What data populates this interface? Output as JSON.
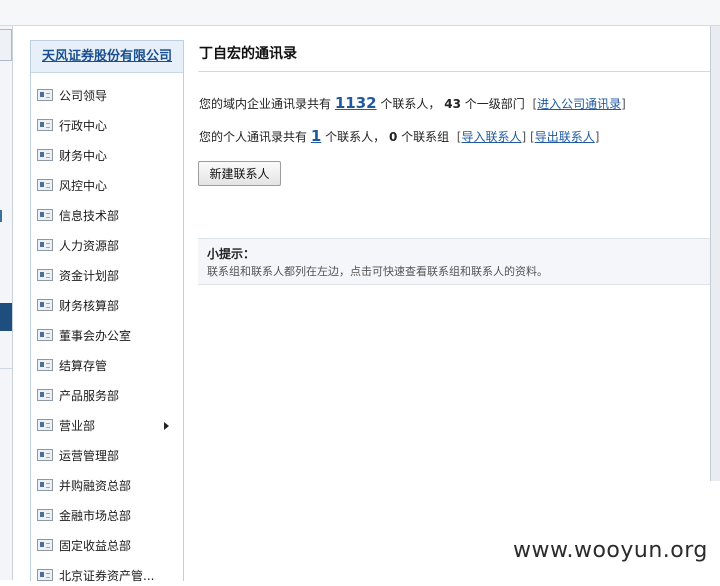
{
  "sidebar": {
    "company": "天风证券股份有限公司",
    "items": [
      {
        "label": "公司领导"
      },
      {
        "label": "行政中心"
      },
      {
        "label": "财务中心"
      },
      {
        "label": "风控中心"
      },
      {
        "label": "信息技术部"
      },
      {
        "label": "人力资源部"
      },
      {
        "label": "资金计划部"
      },
      {
        "label": "财务核算部"
      },
      {
        "label": "董事会办公室"
      },
      {
        "label": "结算存管"
      },
      {
        "label": "产品服务部"
      },
      {
        "label": "营业部",
        "has_children": true
      },
      {
        "label": "运营管理部"
      },
      {
        "label": "并购融资总部"
      },
      {
        "label": "金融市场总部"
      },
      {
        "label": "固定收益总部"
      },
      {
        "label": "北京证券资产管..."
      }
    ],
    "item_icon": "contact-card-icon"
  },
  "main": {
    "title": "丁自宏的通讯录",
    "domain_line": {
      "prefix": "您的域内企业通讯录共有",
      "contacts": "1132",
      "contacts_unit": "个联系人，",
      "depts": "43",
      "depts_unit": "个一级部门",
      "bracket_open": "[",
      "link": "进入公司通讯录",
      "bracket_close": "]"
    },
    "personal_line": {
      "prefix": "您的个人通讯录共有",
      "contacts": "1",
      "contacts_unit": "个联系人，",
      "groups": "0",
      "groups_unit": "个联系组",
      "bracket_open": "[",
      "import_link": "导入联系人",
      "separator": "]  [",
      "export_link": "导出联系人",
      "bracket_close": "]"
    },
    "new_contact_label": "新建联系人",
    "tips": {
      "title": "小提示：",
      "body": "联系组和联系人都列在左边，点击可快速查看联系组和联系人的资料。"
    }
  },
  "watermark": "www.wooyun.org",
  "colors": {
    "accent_link": "#1f5a9e",
    "sidebar_header_bg": "#e7f0f8",
    "tips_bg": "#f4f6f9"
  }
}
